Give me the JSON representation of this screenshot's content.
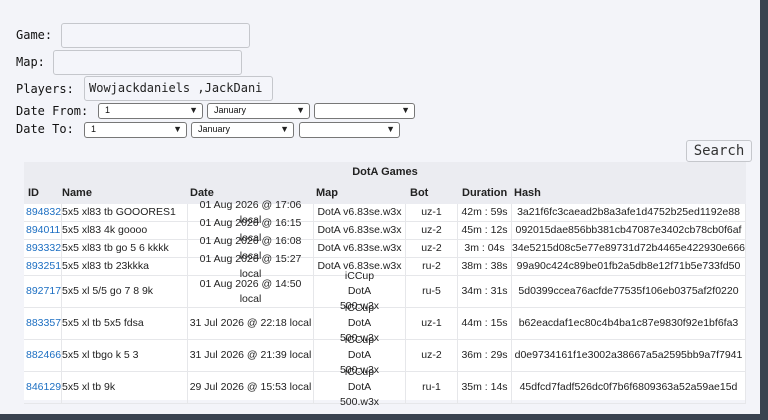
{
  "form": {
    "game_label": "Game:",
    "game_value": "",
    "map_label": "Map:",
    "map_value": "",
    "players_label": "Players:",
    "players_value": "Wowjackdaniels ,JackDani",
    "date_from_label": "Date From:",
    "date_from_day": "1",
    "date_from_month": "January",
    "date_from_year": "",
    "date_to_label": "Date To:",
    "date_to_day": "1",
    "date_to_month": "January",
    "date_to_year": "",
    "search_label": "Search"
  },
  "table": {
    "caption": "DotA Games",
    "headers": {
      "id": "ID",
      "name": "Name",
      "date": "Date",
      "map": "Map",
      "bot": "Bot",
      "duration": "Duration",
      "hash": "Hash"
    },
    "rows": [
      {
        "id": "894832",
        "name": "5x5 xl83 tb GOOORES1",
        "date": "01 Aug 2026 @ 17:06 local",
        "map": "DotA v6.83se.w3x",
        "bot": "uz-1",
        "duration": "42m : 59s",
        "hash": "3a21f6fc3caead2b8a3afe1d4752b25ed1192e88"
      },
      {
        "id": "894011",
        "name": "5x5 xl83 4k goooo",
        "date": "01 Aug 2026 @ 16:15 local",
        "map": "DotA v6.83se.w3x",
        "bot": "uz-2",
        "duration": "45m : 12s",
        "hash": "092015dae856bb381cb47087e3402cb78cb0f6af"
      },
      {
        "id": "893332",
        "name": "5x5 xl83 tb go 5 6 kkkk",
        "date": "01 Aug 2026 @ 16:08 local",
        "map": "DotA v6.83se.w3x",
        "bot": "uz-2",
        "duration": "3m : 04s",
        "hash": "34e5215d08c5e77e89731d72b4465e422930e666"
      },
      {
        "id": "893251",
        "name": "5x5 xl83 tb 23kkka",
        "date": "01 Aug 2026 @ 15:27 local",
        "map": "DotA v6.83se.w3x",
        "bot": "ru-2",
        "duration": "38m : 38s",
        "hash": "99a90c424c89be01fb2a5db8e12f71b5e733fd50"
      },
      {
        "id": "892717",
        "name": "5x5 xl 5/5 go 7 8 9k",
        "date": "01 Aug 2026 @ 14:50 local",
        "map": "iCCup DotA 500.w3x",
        "bot": "ru-5",
        "duration": "34m : 31s",
        "hash": "5d0399ccea76acfde77535f106eb0375af2f0220"
      },
      {
        "id": "883357",
        "name": "5x5 xl tb 5x5 fdsa",
        "date": "31 Jul 2026 @ 22:18 local",
        "map": "iCCup DotA 500.w3x",
        "bot": "uz-1",
        "duration": "44m : 15s",
        "hash": "b62eacdaf1ec80c4b4ba1c87e9830f92e1bf6fa3"
      },
      {
        "id": "882466",
        "name": "5x5 xl tbgo k 5 3",
        "date": "31 Jul 2026 @ 21:39 local",
        "map": "iCCup DotA 500.w3x",
        "bot": "uz-2",
        "duration": "36m : 29s",
        "hash": "d0e9734161f1e3002a38667a5a2595bb9a7f7941"
      },
      {
        "id": "846129",
        "name": "5x5 xl tb 9k",
        "date": "29 Jul 2026 @ 15:53 local",
        "map": "iCCup DotA 500.w3x",
        "bot": "ru-1",
        "duration": "35m : 14s",
        "hash": "45dfcd7fadf526dc0f7b6f6809363a52a59ae15d"
      }
    ]
  }
}
